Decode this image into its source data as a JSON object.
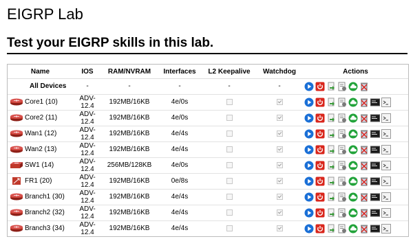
{
  "page": {
    "title": "EIGRP Lab",
    "subtitle": "Test your EIGRP skills in this lab."
  },
  "table": {
    "headers": [
      "Name",
      "IOS",
      "RAM/NVRAM",
      "Interfaces",
      "L2 Keepalive",
      "Watchdog",
      "Actions"
    ],
    "all_devices": {
      "name": "All Devices",
      "ios": "-",
      "ram": "-",
      "interfaces": "-",
      "keepalive": "-",
      "watchdog": "-"
    },
    "rows": [
      {
        "icon": "router",
        "name": "Core1 (10)",
        "ios": "ADV-12.4",
        "ram": "192MB/16KB",
        "interfaces": "4e/0s",
        "keepalive": false,
        "watchdog": true
      },
      {
        "icon": "router",
        "name": "Core2 (11)",
        "ios": "ADV-12.4",
        "ram": "192MB/16KB",
        "interfaces": "4e/0s",
        "keepalive": false,
        "watchdog": true
      },
      {
        "icon": "router",
        "name": "Wan1 (12)",
        "ios": "ADV-12.4",
        "ram": "192MB/16KB",
        "interfaces": "4e/4s",
        "keepalive": false,
        "watchdog": true
      },
      {
        "icon": "router",
        "name": "Wan2 (13)",
        "ios": "ADV-12.4",
        "ram": "192MB/16KB",
        "interfaces": "4e/4s",
        "keepalive": false,
        "watchdog": true
      },
      {
        "icon": "switch",
        "name": "SW1 (14)",
        "ios": "ADV-12.4",
        "ram": "256MB/128KB",
        "interfaces": "4e/0s",
        "keepalive": false,
        "watchdog": true
      },
      {
        "icon": "frame-relay",
        "name": "FR1 (20)",
        "ios": "ADV-12.4",
        "ram": "192MB/16KB",
        "interfaces": "0e/8s",
        "keepalive": false,
        "watchdog": true
      },
      {
        "icon": "router",
        "name": "Branch1 (30)",
        "ios": "ADV-12.4",
        "ram": "192MB/16KB",
        "interfaces": "4e/4s",
        "keepalive": false,
        "watchdog": true
      },
      {
        "icon": "router",
        "name": "Branch2 (32)",
        "ios": "ADV-12.4",
        "ram": "192MB/16KB",
        "interfaces": "4e/4s",
        "keepalive": false,
        "watchdog": true
      },
      {
        "icon": "router",
        "name": "Branch3 (34)",
        "ios": "ADV-12.4",
        "ram": "192MB/16KB",
        "interfaces": "4e/4s",
        "keepalive": false,
        "watchdog": true
      }
    ],
    "actions_all": [
      "start-icon",
      "stop-icon",
      "export-config-icon",
      "config-notes-icon",
      "upload-cloud-icon",
      "wipe-icon"
    ],
    "actions_row": [
      "start-icon",
      "stop-icon",
      "export-config-icon",
      "config-notes-icon",
      "upload-cloud-icon",
      "wipe-icon",
      "console-icon",
      "telnet-icon"
    ]
  },
  "colors": {
    "start": "#1a6fd6",
    "stop": "#d9261c",
    "cloud": "#22a33a",
    "router": "#c0392b"
  }
}
